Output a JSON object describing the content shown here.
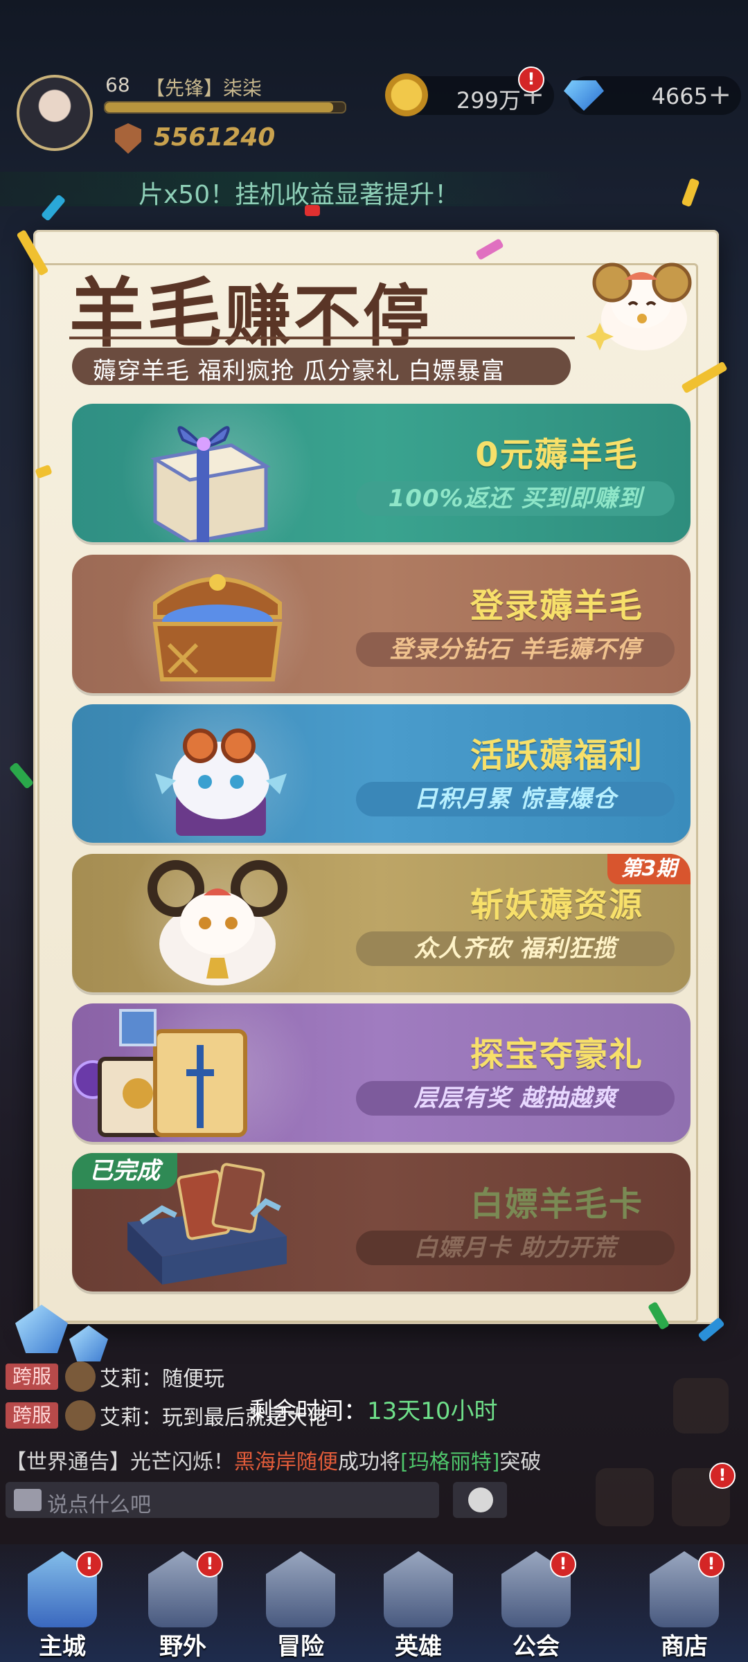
{
  "hud": {
    "level": "68",
    "player_name": "【先锋】柒柒",
    "exp_fraction": 0.95,
    "power": "5561240",
    "gold": "299万",
    "diamonds": "4665",
    "plus": "+",
    "alert": "!",
    "banner": "片x50！挂机收益显著提升！"
  },
  "modal": {
    "title_a": "羊毛",
    "title_b": "赚不停",
    "subtitle": "薅穿羊毛 福利疯抢 瓜分豪礼 白嫖暴富",
    "cards": [
      {
        "title": "0元薅羊毛",
        "desc": "100%返还  买到即赚到"
      },
      {
        "title": "登录薅羊毛",
        "desc": "登录分钻石  羊毛薅不停"
      },
      {
        "title": "活跃薅福利",
        "desc": "日积月累  惊喜爆仓"
      },
      {
        "title": "斩妖薅资源",
        "desc": "众人齐砍  福利狂揽",
        "tag": "第3期"
      },
      {
        "title": "探宝夺豪礼",
        "desc": "层层有奖  越抽越爽"
      },
      {
        "title": "白嫖羊毛卡",
        "desc": "白嫖月卡  助力开荒",
        "tag": "已完成"
      }
    ]
  },
  "chat": {
    "lines": [
      {
        "tag": "跨服",
        "text": "艾莉：随便玩"
      },
      {
        "tag": "跨服",
        "text": "艾莉：玩到最后就是大佬"
      }
    ],
    "world_prefix": "【世界通告】光芒闪烁！",
    "world_name": "黑海岸随便",
    "world_mid": "成功将",
    "world_hero": "[玛格丽特]",
    "world_suffix": "突破",
    "input_placeholder": "说点什么吧"
  },
  "remaining": {
    "label": "剩余时间：",
    "value": "13天10小时"
  },
  "nav": [
    "主城",
    "野外",
    "冒险",
    "英雄",
    "公会",
    "商店"
  ],
  "colors": {
    "panel": "#f6f0df",
    "title": "#5a3526",
    "accent_yellow": "#f7e06a",
    "timer_green": "#6fe08a"
  }
}
